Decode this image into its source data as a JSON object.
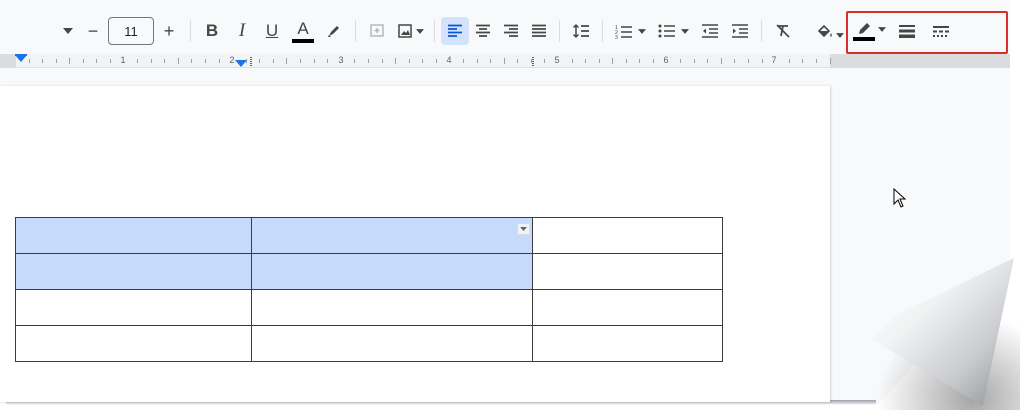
{
  "toolbar": {
    "font_size": "11",
    "decrease_font_label": "−",
    "increase_font_label": "+",
    "bold_label": "B",
    "italic_label": "I",
    "underline_label": "U",
    "text_color_label": "A",
    "text_color": "#000000",
    "border_color": "#000000",
    "highlight_outline_color": "#d93025",
    "icons": {
      "highlight": "marker-icon",
      "comment": "add-comment-icon",
      "image": "insert-image-icon",
      "align_left": "align-left-icon",
      "align_center": "align-center-icon",
      "align_right": "align-right-icon",
      "justify": "align-justify-icon",
      "line_spacing": "line-spacing-icon",
      "numbered_list": "numbered-list-icon",
      "bulleted_list": "bulleted-list-icon",
      "decrease_indent": "decrease-indent-icon",
      "increase_indent": "increase-indent-icon",
      "clear_formatting": "clear-formatting-icon",
      "background_color": "paint-bucket-icon",
      "border_color": "pen-icon",
      "border_width": "border-width-icon",
      "border_dash": "border-dash-icon"
    }
  },
  "ruler": {
    "numbers": [
      "1",
      "2",
      "3",
      "4",
      "5",
      "6",
      "7"
    ]
  },
  "table": {
    "rows": 4,
    "cols": 3,
    "selected_cells": [
      [
        0,
        0
      ],
      [
        0,
        1
      ],
      [
        1,
        0
      ],
      [
        1,
        1
      ]
    ],
    "selection_color": "#c6dafc"
  }
}
